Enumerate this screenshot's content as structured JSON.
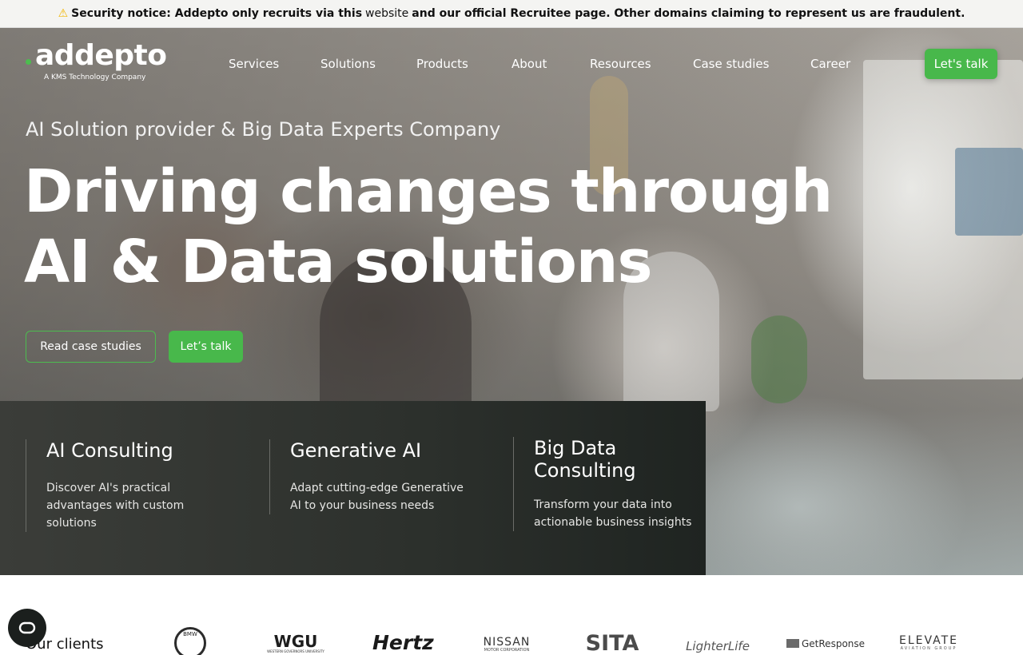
{
  "notice": {
    "icon": "warning-icon",
    "text_bold_1": "Security notice: Addepto only recruits via this",
    "text_plain": "website",
    "text_bold_2": "and our official Recruitee page. Other domains claiming to represent us are fraudulent."
  },
  "logo": {
    "name": "addepto",
    "subtitle": "A KMS Technology Company",
    "accent": "#4cbd4f"
  },
  "nav": {
    "items": [
      "Services",
      "Solutions",
      "Products",
      "About",
      "Resources",
      "Case studies",
      "Career"
    ],
    "cta": "Let's talk"
  },
  "hero": {
    "tagline": "AI Solution provider & Big Data Experts Company",
    "headline_line1": "Driving changes through",
    "headline_line2": "AI & Data solutions",
    "btn_case_studies": "Read case studies",
    "btn_talk": "Let’s talk"
  },
  "cards": [
    {
      "title": "AI Consulting",
      "body": "Discover AI's practical advantages with custom solutions"
    },
    {
      "title": "Generative AI",
      "body": "Adapt cutting-edge Generative AI to your business needs"
    },
    {
      "title": "Big Data Consulting",
      "body": "Transform your data into actionable business insights"
    }
  ],
  "clients": {
    "label": "Our clients",
    "logos": [
      "BMW",
      "WGU",
      "Hertz",
      "NISSAN",
      "SITA",
      "LighterLife",
      "GetResponse",
      "ELEVATE"
    ],
    "wgu_sub": "WESTERN GOVERNORS UNIVERSITY",
    "nissan_sub": "MOTOR CORPORATION",
    "elevate_sub": "AVIATION GROUP"
  },
  "colors": {
    "brand_green": "#48b84b",
    "card_bg": "#2c302c"
  },
  "cookie_button": {
    "icon": "cookie-consent-icon"
  }
}
